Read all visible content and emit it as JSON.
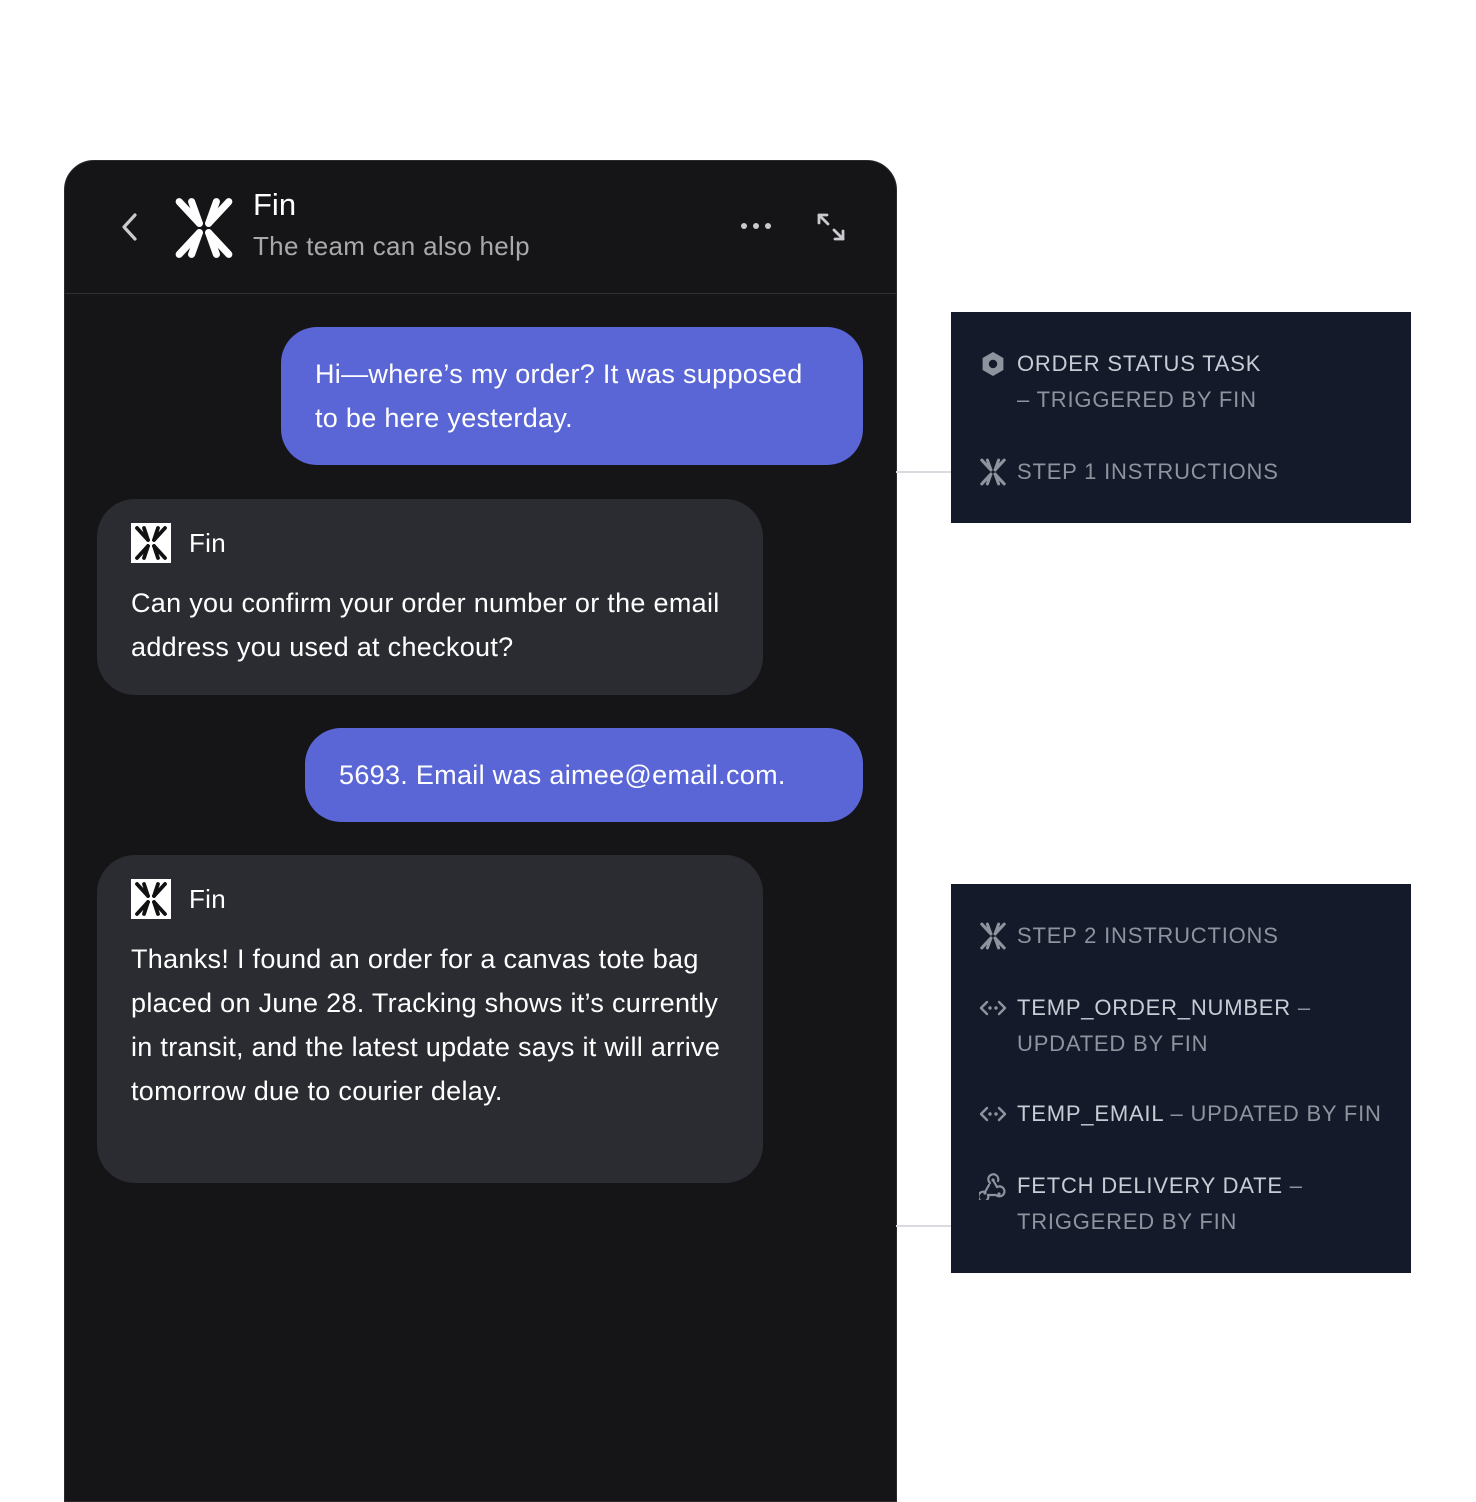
{
  "header": {
    "title": "Fin",
    "subtitle": "The team can also help",
    "icons": {
      "back": "chevron-left-icon",
      "logo": "fin-logo-icon",
      "more": "more-dots-icon",
      "expand": "expand-icon"
    }
  },
  "messages": [
    {
      "from": "user",
      "text": "Hi—where’s my order? It was supposed to be here yesterday."
    },
    {
      "from": "fin",
      "name": "Fin",
      "text": "Can you confirm your order number or the email address you used at checkout?"
    },
    {
      "from": "user",
      "text": "5693. Email was aimee@email.com."
    },
    {
      "from": "fin",
      "name": "Fin",
      "text": "Thanks! I found an order for a canvas tote bag placed on June 28. Tracking shows it’s currently in transit, and the latest update says it will arrive tomorrow due to courier delay."
    }
  ],
  "panel1": {
    "items": [
      {
        "icon": "hexagon-icon",
        "main": "ORDER STATUS TASK",
        "sep": " – ",
        "sub": "TRIGGERED BY FIN"
      },
      {
        "icon": "fin-logo-icon",
        "main": "STEP 1 INSTRUCTIONS",
        "sep": "",
        "sub": ""
      }
    ]
  },
  "panel2": {
    "items": [
      {
        "icon": "fin-logo-icon",
        "main": "STEP 2 INSTRUCTIONS",
        "sep": "",
        "sub": ""
      },
      {
        "icon": "code-icon",
        "main": "TEMP_ORDER_NUMBER",
        "sep": " – ",
        "sub": "UPDATED BY FIN"
      },
      {
        "icon": "code-icon",
        "main": "TEMP_EMAIL",
        "sep": " – ",
        "sub": "UPDATED BY FIN"
      },
      {
        "icon": "webhook-icon",
        "main": "FETCH DELIVERY DATE",
        "sep": " – ",
        "sub": "TRIGGERED BY FIN"
      }
    ]
  },
  "colors": {
    "user_bubble": "#5a66d6",
    "fin_bubble": "#2b2c31",
    "chat_bg": "#151518",
    "panel_bg": "#141a2a"
  }
}
